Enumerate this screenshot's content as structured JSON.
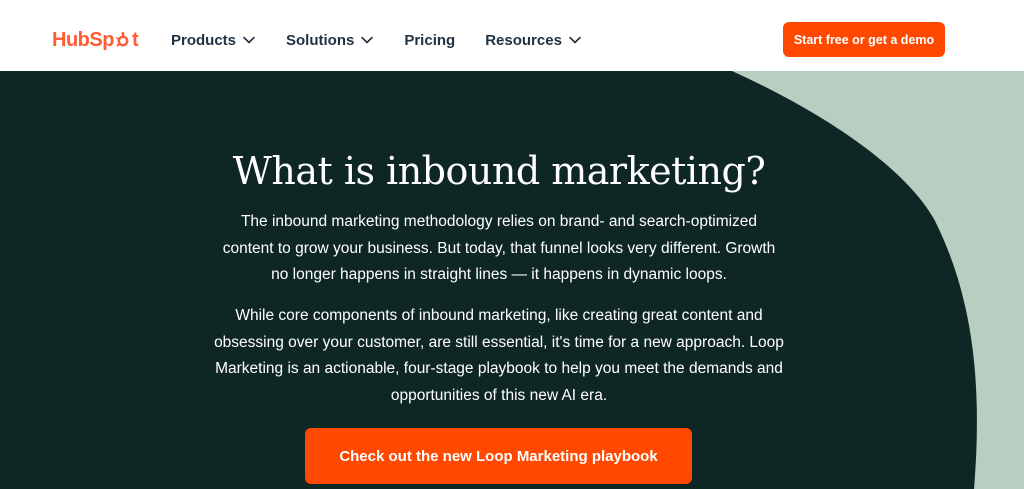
{
  "brand": {
    "logo_text_a": "HubSp",
    "logo_text_b": "t",
    "logo_icon": "sprocket-icon",
    "color": "#ff5c35"
  },
  "nav": {
    "items": [
      {
        "label": "Products",
        "has_dropdown": true
      },
      {
        "label": "Solutions",
        "has_dropdown": true
      },
      {
        "label": "Pricing",
        "has_dropdown": false
      },
      {
        "label": "Resources",
        "has_dropdown": true
      }
    ],
    "cta_label": "Start free or get a demo"
  },
  "hero": {
    "title": "What is inbound marketing?",
    "paragraph_1": "The inbound marketing methodology relies on brand- and search-optimized content to grow your business. But today, that funnel looks very different. Growth no longer happens in straight lines — it happens in dynamic loops.",
    "paragraph_2": "While core components of inbound marketing, like creating great content and obsessing over your customer, are still essential, it's time for a new approach. Loop Marketing is an actionable, four-stage playbook to help you meet the demands and opportunities of this new AI era.",
    "cta_label": "Check out the new Loop Marketing playbook"
  },
  "colors": {
    "accent": "#ff4800",
    "hero_dark": "#0f2724",
    "hero_light": "#b7cec0",
    "nav_text": "#213343"
  }
}
